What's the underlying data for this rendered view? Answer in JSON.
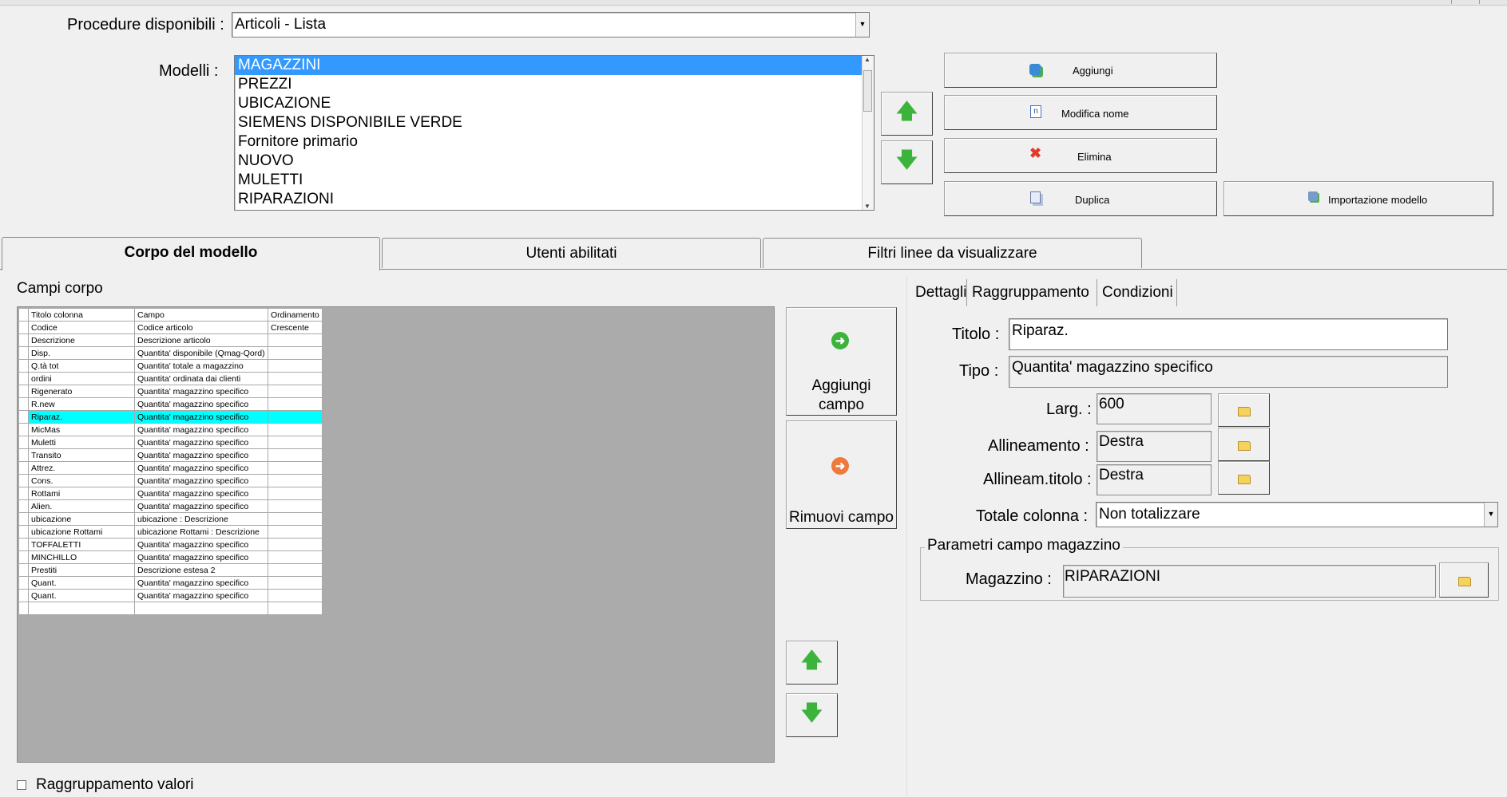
{
  "header": {
    "procedure_label": "Procedure disponibili :",
    "procedure_value": "Articoli - Lista",
    "models_label": "Modelli :",
    "models": [
      "MAGAZZINI",
      "PREZZI",
      "UBICAZIONE",
      "SIEMENS DISPONIBILE VERDE",
      "Fornitore primario",
      "NUOVO",
      "MULETTI",
      "RIPARAZIONI"
    ],
    "selected_model": "MAGAZZINI"
  },
  "model_buttons": {
    "add": "Aggiungi",
    "rename": "Modifica nome",
    "delete": "Elimina",
    "duplicate": "Duplica",
    "import": "Importazione modello"
  },
  "tabs": [
    "Corpo del modello",
    "Utenti abilitati",
    "Filtri linee da visualizzare"
  ],
  "body": {
    "section_title": "Campi corpo",
    "grid_columns": [
      "Titolo colonna",
      "Campo",
      "Ordinamento"
    ],
    "grid_rows": [
      [
        "Codice",
        "Codice articolo",
        "Crescente"
      ],
      [
        "Descrizione",
        "Descrizione articolo",
        ""
      ],
      [
        "Disp.",
        "Quantita' disponibile (Qmag-Qord)",
        ""
      ],
      [
        "Q.tà tot",
        "Quantita' totale a magazzino",
        ""
      ],
      [
        "ordini",
        "Quantita' ordinata dai clienti",
        ""
      ],
      [
        "Rigenerato",
        "Quantita' magazzino specifico",
        ""
      ],
      [
        "R.new",
        "Quantita' magazzino specifico",
        ""
      ],
      [
        "Riparaz.",
        "Quantita' magazzino specifico",
        ""
      ],
      [
        "MicMas",
        "Quantita' magazzino specifico",
        ""
      ],
      [
        "Muletti",
        "Quantita' magazzino specifico",
        ""
      ],
      [
        "Transito",
        "Quantita' magazzino specifico",
        ""
      ],
      [
        "Attrez.",
        "Quantita' magazzino specifico",
        ""
      ],
      [
        "Cons.",
        "Quantita' magazzino specifico",
        ""
      ],
      [
        "Rottami",
        "Quantita' magazzino specifico",
        ""
      ],
      [
        "Alien.",
        "Quantita' magazzino specifico",
        ""
      ],
      [
        "ubicazione",
        "ubicazione : Descrizione",
        ""
      ],
      [
        "ubicazione Rottami",
        "ubicazione Rottami : Descrizione",
        ""
      ],
      [
        "TOFFALETTI",
        "Quantita' magazzino specifico",
        ""
      ],
      [
        "MINCHILLO",
        "Quantita' magazzino specifico",
        ""
      ],
      [
        "Prestiti",
        "Descrizione estesa 2",
        ""
      ],
      [
        "Quant.",
        "Quantita' magazzino specifico",
        ""
      ],
      [
        "Quant.",
        "Quantita' magazzino specifico",
        ""
      ],
      [
        "",
        "",
        ""
      ]
    ],
    "selected_row": "Riparaz.",
    "add_field_line1": "Aggiungi",
    "add_field_line2": "campo",
    "remove_field": "Rimuovi campo",
    "group_values": "Raggruppamento valori"
  },
  "details": {
    "subtabs": [
      "Dettagli",
      "Raggruppamento",
      "Condizioni"
    ],
    "title_label": "Titolo :",
    "title_value": "Riparaz.",
    "type_label": "Tipo :",
    "type_value": "Quantita' magazzino specifico",
    "width_label": "Larg. :",
    "width_value": "600",
    "align_label": "Allineamento :",
    "align_value": "Destra",
    "title_align_label": "Allineam.titolo :",
    "title_align_value": "Destra",
    "total_label": "Totale colonna :",
    "total_value": "Non totalizzare",
    "group_title": "Parametri campo magazzino",
    "warehouse_label": "Magazzino :",
    "warehouse_value": "RIPARAZIONI"
  },
  "colors": {
    "selection_blue": "#3399ff",
    "selection_cyan": "#00ffff",
    "grid_background": "#ababab",
    "arrow_green": "#3cb43c"
  }
}
